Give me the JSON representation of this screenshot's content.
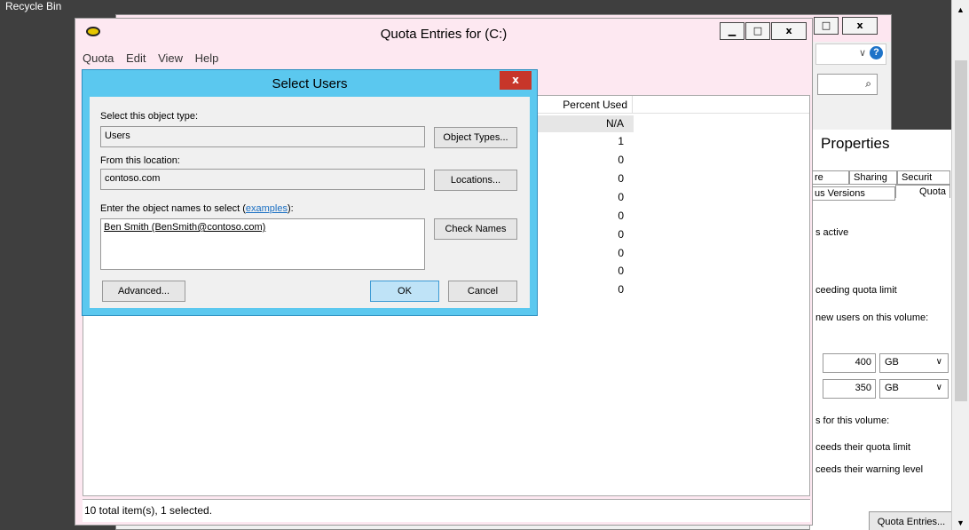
{
  "desktop": {
    "recycle_bin": "Recycle Bin"
  },
  "back_window": {
    "min_label": "",
    "close_label": "x",
    "max_label": "",
    "search_icon": "search-icon"
  },
  "properties": {
    "title": "Properties",
    "tabs": [
      "re",
      "Sharing",
      "Securit",
      "us Versions",
      "Quota"
    ],
    "lines": {
      "active": "s active",
      "exceeding": "ceeding quota limit",
      "new_users": "new users on this volume:",
      "for_volume": "s for this volume:",
      "exceeds_limit": "ceeds their quota limit",
      "exceeds_warning": "ceeds their warning level"
    },
    "limit_value": "400",
    "limit_unit": "GB",
    "warning_value": "350",
    "warning_unit": "GB",
    "quota_entries_button": "Quota Entries..."
  },
  "quota_window": {
    "title": "Quota Entries for  (C:)",
    "menu": [
      "Quota",
      "Edit",
      "View",
      "Help"
    ],
    "column_percent_used": "Percent Used",
    "percent_values": [
      "N/A",
      "1",
      "0",
      "0",
      "0",
      "0",
      "0",
      "0",
      "0",
      "0"
    ],
    "status": "10 total item(s), 1 selected."
  },
  "select_users": {
    "title": "Select Users",
    "close_label": "x",
    "object_type_label": "Select this object type:",
    "object_type_value": "Users",
    "object_types_button": "Object Types...",
    "location_label": "From this location:",
    "location_value": "contoso.com",
    "locations_button": "Locations...",
    "names_label_prefix": "Enter the object names to select (",
    "names_label_link": "examples",
    "names_label_suffix": "):",
    "names_value": "Ben Smith (BenSmith@contoso.com)",
    "check_names_button": "Check Names",
    "advanced_button": "Advanced...",
    "ok_button": "OK",
    "cancel_button": "Cancel"
  }
}
